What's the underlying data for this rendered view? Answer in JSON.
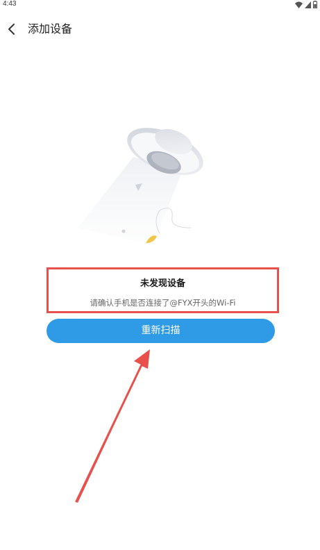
{
  "status_bar": {
    "time": "4:43",
    "icons": [
      "wifi-icon",
      "signal-icon",
      "battery-icon"
    ]
  },
  "nav": {
    "back_icon": "chevron-left-icon",
    "title": "添加设备"
  },
  "illustration": {
    "description_icon": "ufo-icon"
  },
  "message": {
    "title": "未发现设备",
    "subtitle": "请确认手机是否连接了@FYX开头的Wi-Fi"
  },
  "actions": {
    "rescan_label": "重新扫描"
  },
  "colors": {
    "accent": "#2f9ae5",
    "annotation": "#e8504c",
    "background": "#ffffff"
  }
}
